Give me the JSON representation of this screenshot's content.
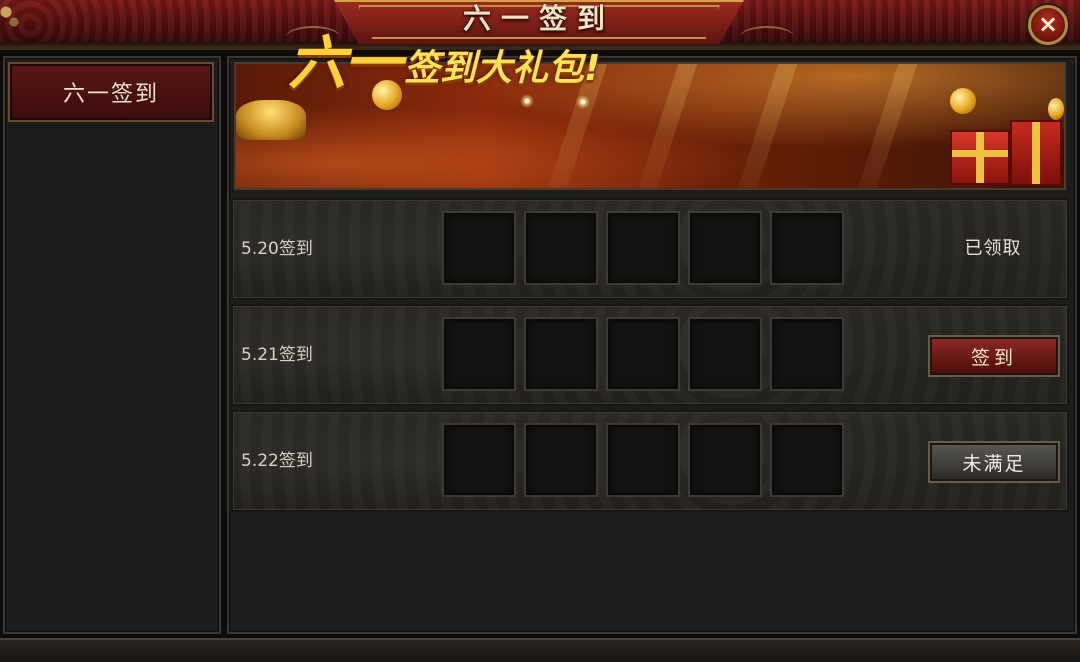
{
  "window": {
    "title": "六一签到",
    "close_label": "×"
  },
  "sidebar": {
    "items": [
      {
        "label": "六一签到",
        "active": true
      }
    ]
  },
  "banner": {
    "title_big": "六一",
    "title_small": "签到大礼包!"
  },
  "rows": [
    {
      "label": "5.20签到",
      "status": "已领取",
      "state": "claimed",
      "reward_slots": 5
    },
    {
      "label": "5.21签到",
      "button": "签到",
      "state": "available",
      "reward_slots": 5
    },
    {
      "label": "5.22签到",
      "button": "未满足",
      "state": "locked",
      "reward_slots": 5
    }
  ],
  "colors": {
    "header_red": "#7a1a1a",
    "title_gold": "#f5e3c0",
    "banner_yellow": "#ffd13a",
    "button_red": "#8e2a24",
    "button_gray": "#5a5854",
    "panel_bg": "#1c1c1c"
  },
  "icons": {
    "close": "close-icon"
  }
}
